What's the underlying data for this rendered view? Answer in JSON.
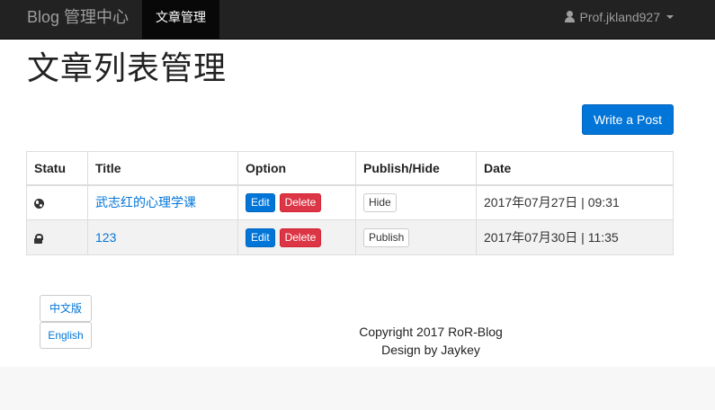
{
  "navbar": {
    "brand": "Blog 管理中心",
    "active_item": "文章管理",
    "user_name": "Prof.jkland927"
  },
  "page": {
    "title": "文章列表管理",
    "write_button": "Write a Post"
  },
  "table": {
    "headers": [
      "Statu",
      "Title",
      "Option",
      "Publish/Hide",
      "Date"
    ],
    "rows": [
      {
        "status_icon": "globe-icon",
        "title": "武志红的心理学课",
        "edit": "Edit",
        "delete": "Delete",
        "toggle": "Hide",
        "date": "2017年07月27日 | 09:31"
      },
      {
        "status_icon": "lock-icon",
        "title": "123",
        "edit": "Edit",
        "delete": "Delete",
        "toggle": "Publish",
        "date": "2017年07月30日 | 11:35"
      }
    ]
  },
  "languages": {
    "zh": "中文版",
    "en": "English"
  },
  "footer": {
    "copyright": "Copyright 2017 RoR-Blog",
    "design": "Design by Jaykey"
  },
  "colors": {
    "navbar_bg": "#222222",
    "primary": "#0275d8",
    "danger": "#dc3545"
  }
}
